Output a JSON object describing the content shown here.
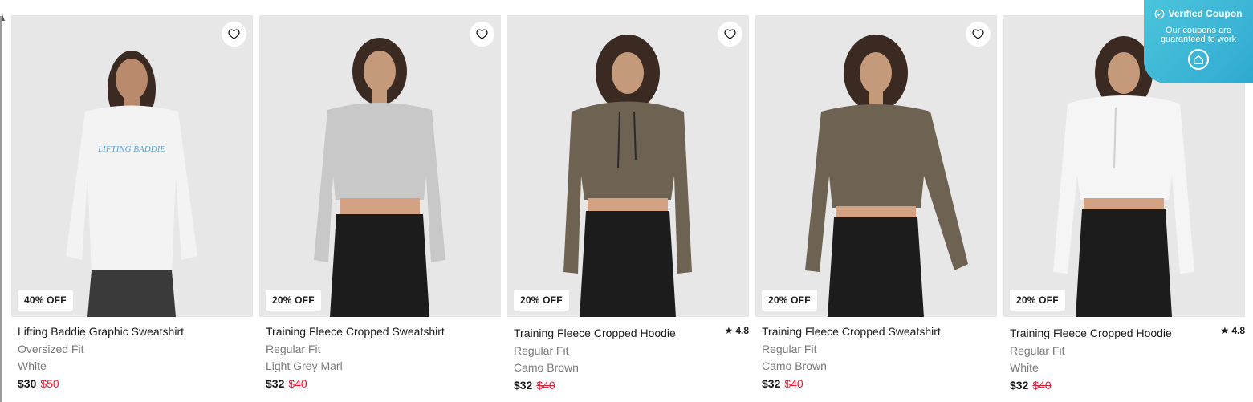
{
  "products": [
    {
      "title": "Lifting Baddie Graphic Sweatshirt",
      "fit": "Oversized Fit",
      "color": "White",
      "price": "$30",
      "was_price": "$50",
      "badge": "40% OFF",
      "rating": "",
      "top_color": "#f3f3f3",
      "bottom_color": "#3a3a3a",
      "graphic": "LIFTING BADDIE"
    },
    {
      "title": "Training Fleece Cropped Sweatshirt",
      "fit": "Regular Fit",
      "color": "Light Grey Marl",
      "price": "$32",
      "was_price": "$40",
      "badge": "20% OFF",
      "rating": "",
      "top_color": "#c8c8c8",
      "bottom_color": "#1c1c1c",
      "graphic": ""
    },
    {
      "title": "Training Fleece Cropped Hoodie",
      "fit": "Regular Fit",
      "color": "Camo Brown",
      "price": "$32",
      "was_price": "$40",
      "badge": "20% OFF",
      "rating": "4.8",
      "top_color": "#6e6253",
      "bottom_color": "#1c1c1c",
      "graphic": ""
    },
    {
      "title": "Training Fleece Cropped Sweatshirt",
      "fit": "Regular Fit",
      "color": "Camo Brown",
      "price": "$32",
      "was_price": "$40",
      "badge": "20% OFF",
      "rating": "",
      "top_color": "#6e6253",
      "bottom_color": "#1c1c1c",
      "graphic": ""
    },
    {
      "title": "Training Fleece Cropped Hoodie",
      "fit": "Regular Fit",
      "color": "White",
      "price": "$32",
      "was_price": "$40",
      "badge": "20% OFF",
      "rating": "4.8",
      "top_color": "#f5f5f5",
      "bottom_color": "#1c1c1c",
      "graphic": ""
    }
  ],
  "coupon": {
    "title": "Verified Coupon",
    "subtitle": "Our coupons are guaranteed to work"
  },
  "icons": {
    "wishlist": "heart-outline-icon",
    "rating": "star-icon",
    "verified": "check-circle-icon",
    "coupon_logo": "house-logo-icon"
  }
}
